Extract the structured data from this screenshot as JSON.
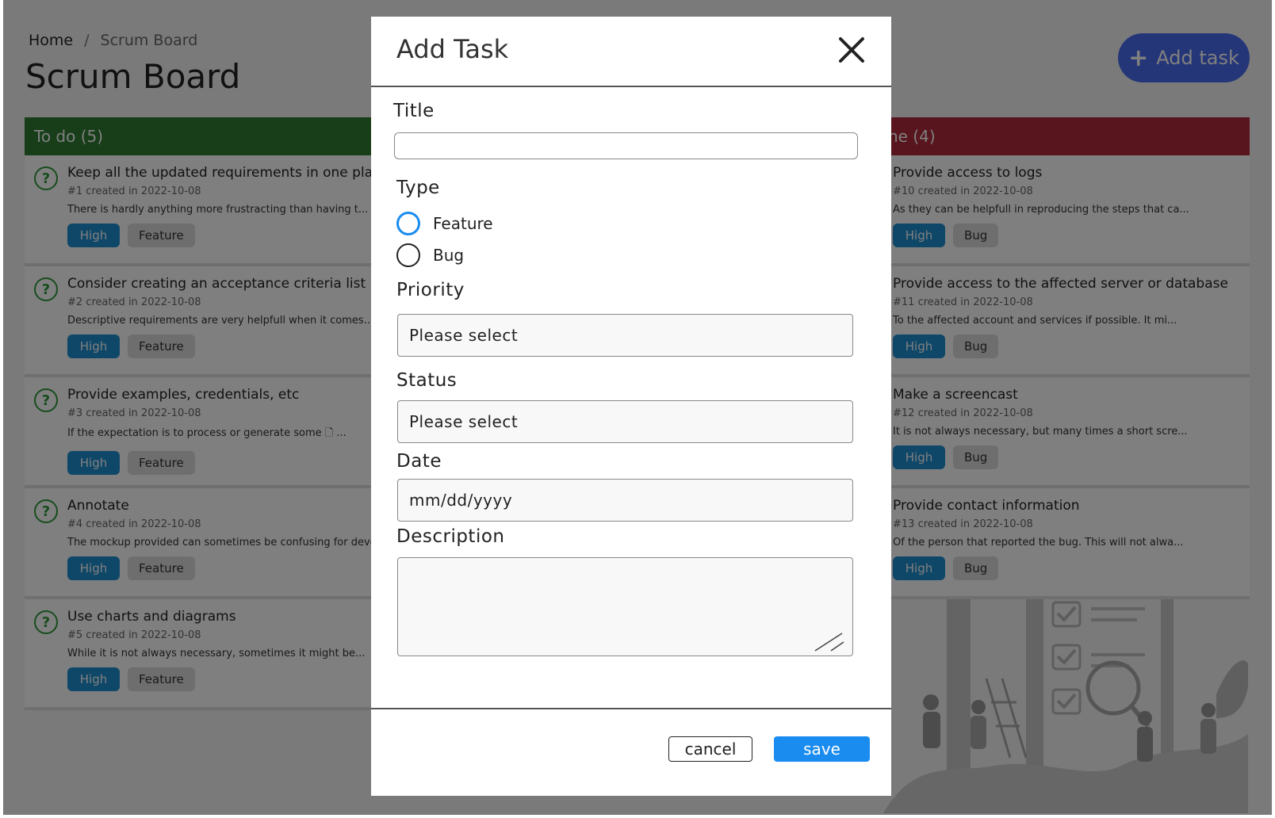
{
  "breadcrumb": {
    "home": "Home",
    "separator": "/",
    "current": "Scrum Board"
  },
  "page_title": "Scrum Board",
  "add_task_button": {
    "plus": "+",
    "label": "Add task"
  },
  "columns": {
    "todo": {
      "header": "To do (5)",
      "cards": [
        {
          "icon": "?",
          "title": "Keep all the updated requirements in one place",
          "meta": "#1 created in 2022-10-08",
          "desc": "There is hardly anything more frustracting than having t...",
          "priority": "High",
          "type": "Feature"
        },
        {
          "icon": "?",
          "title": "Consider creating an acceptance criteria list",
          "meta": "#2 created in 2022-10-08",
          "desc": "Descriptive requirements are very helpfull when it comes...",
          "priority": "High",
          "type": "Feature"
        },
        {
          "icon": "?",
          "title": "Provide examples, credentials, etc",
          "meta": "#3 created in 2022-10-08",
          "desc": "If the expectation is to process or generate some 🗋 ...",
          "priority": "High",
          "type": "Feature"
        },
        {
          "icon": "?",
          "title": "Annotate",
          "meta": "#4 created in 2022-10-08",
          "desc": "The mockup provided can sometimes be confusing for deve...",
          "priority": "High",
          "type": "Feature"
        },
        {
          "icon": "?",
          "title": "Use charts and diagrams",
          "meta": "#5 created in 2022-10-08",
          "desc": "While it is not always necessary, sometimes it might be...",
          "priority": "High",
          "type": "Feature"
        }
      ]
    },
    "done": {
      "header": "ne (4)",
      "cards": [
        {
          "icon": "✓",
          "title": "Provide access to logs",
          "meta": "#10 created in 2022-10-08",
          "desc": "As they can be helpfull in reproducing the steps that ca...",
          "priority": "High",
          "type": "Bug"
        },
        {
          "icon": "✓",
          "title": "Provide access to the affected server or database",
          "meta": "#11 created in 2022-10-08",
          "desc": "To the affected account and services if possible. It mi...",
          "priority": "High",
          "type": "Bug"
        },
        {
          "icon": "✓",
          "title": "Make a screencast",
          "meta": "#12 created in 2022-10-08",
          "desc": "It is not always necessary, but many times a short scre...",
          "priority": "High",
          "type": "Bug"
        },
        {
          "icon": "✓",
          "title": "Provide contact information",
          "meta": "#13 created in 2022-10-08",
          "desc": "Of the person that reported the bug. This will not alwa...",
          "priority": "High",
          "type": "Bug"
        }
      ]
    }
  },
  "modal": {
    "title": "Add Task",
    "close_icon": "close-icon",
    "labels": {
      "title": "Title",
      "type": "Type",
      "priority": "Priority",
      "status": "Status",
      "date": "Date",
      "description": "Description"
    },
    "title_value": "",
    "type_options": [
      {
        "label": "Feature",
        "selected": true
      },
      {
        "label": "Bug",
        "selected": false
      }
    ],
    "priority_value": "Please select",
    "status_value": "Please select",
    "date_placeholder": "mm/dd/yyyy",
    "description_value": "",
    "cancel_label": "cancel",
    "save_label": "save"
  },
  "colors": {
    "todo_header": "#2e7d32",
    "done_header": "#b22a3c",
    "accent_blue": "#1a8cf0",
    "add_task": "#4a6df0",
    "priority_tag": "#1f8fd1"
  }
}
